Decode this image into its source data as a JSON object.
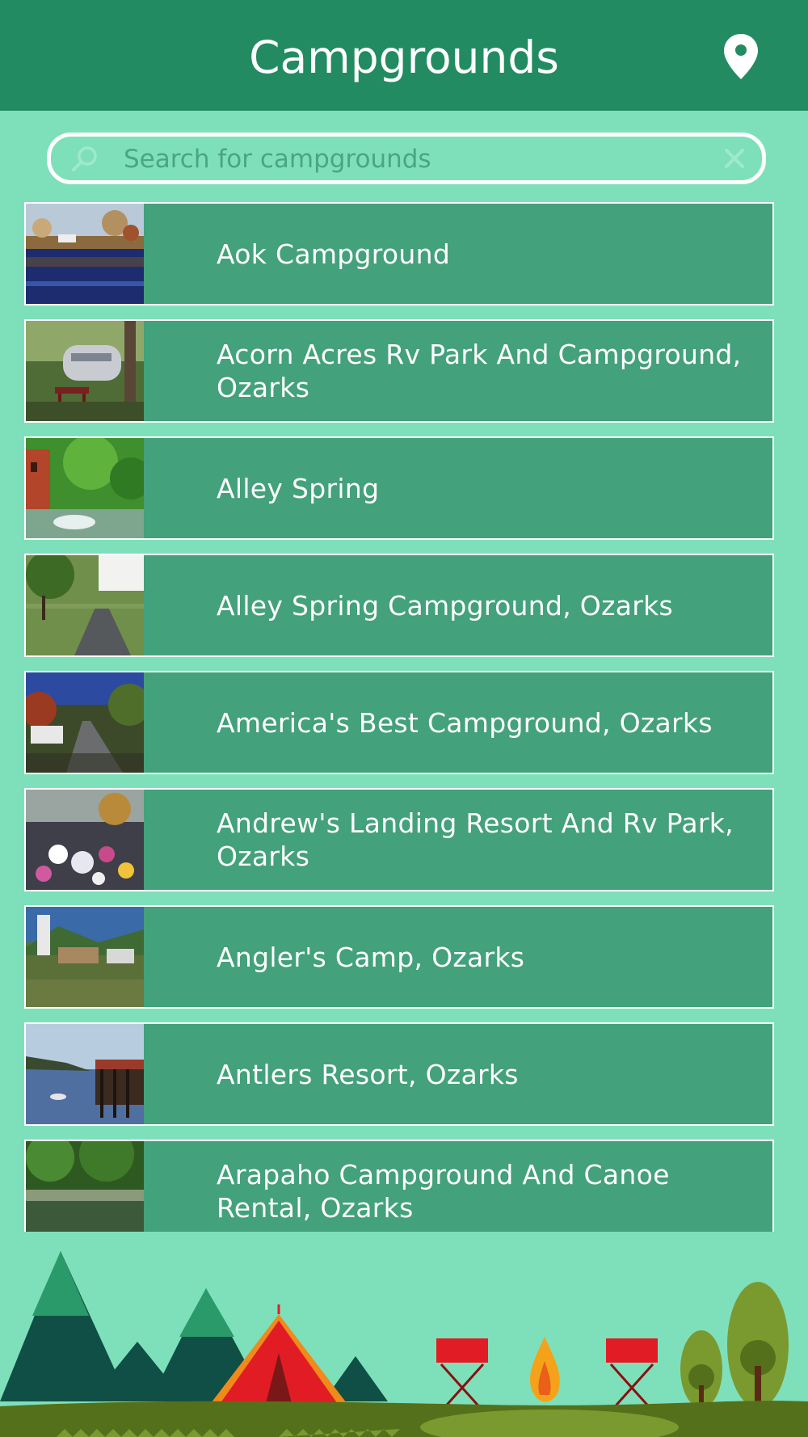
{
  "header": {
    "title": "Campgrounds",
    "location_icon": "map-pin-icon"
  },
  "search": {
    "placeholder": "Search for campgrounds",
    "value": "",
    "search_icon": "magnifier-icon",
    "clear_icon": "close-icon"
  },
  "campgrounds": [
    {
      "name": "Aok Campground",
      "thumbnail": "lake-reflection-photo"
    },
    {
      "name": "Acorn Acres Rv Park And Campground, Ozarks",
      "thumbnail": "airstream-trailer-photo"
    },
    {
      "name": "Alley Spring",
      "thumbnail": "red-mill-spring-photo"
    },
    {
      "name": "Alley Spring Campground, Ozarks",
      "thumbnail": "campground-road-photo"
    },
    {
      "name": "America's Best Campground, Ozarks",
      "thumbnail": "rv-sites-photo"
    },
    {
      "name": "Andrew's Landing Resort And Rv Park, Ozarks",
      "thumbnail": "flower-garden-photo"
    },
    {
      "name": "Angler's Camp, Ozarks",
      "thumbnail": "camp-sign-photo"
    },
    {
      "name": "Antlers Resort, Ozarks",
      "thumbnail": "lake-dock-photo"
    },
    {
      "name": "Arapaho Campground And Canoe Rental, Ozarks",
      "thumbnail": "river-forest-photo"
    }
  ],
  "colors": {
    "header": "#228b62",
    "background": "#7ee0bb",
    "row": "#43a17c",
    "text": "#ffffff"
  }
}
